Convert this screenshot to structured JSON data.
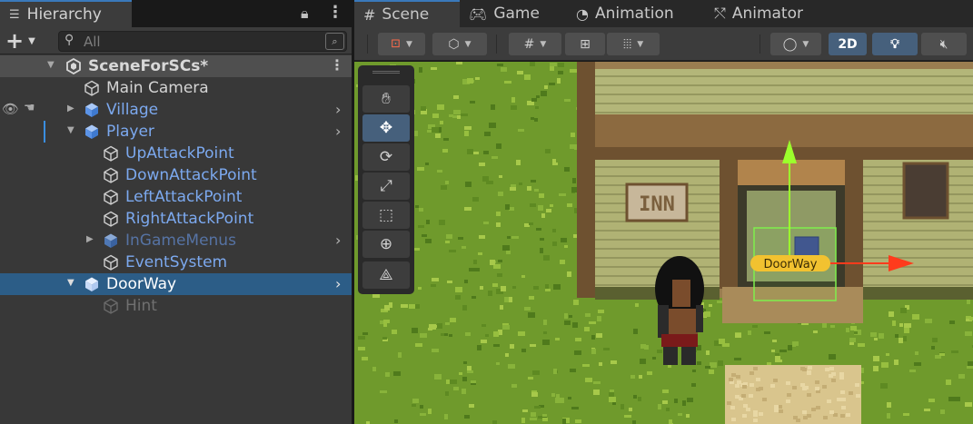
{
  "hierarchy": {
    "tab_label": "Hierarchy",
    "tab_icon": "list-icon",
    "search_placeholder": "All",
    "scene_name": "SceneForSCs*",
    "items": [
      {
        "label": "Main Camera"
      },
      {
        "label": "Village"
      },
      {
        "label": "Player"
      },
      {
        "label": "UpAttackPoint"
      },
      {
        "label": "DownAttackPoint"
      },
      {
        "label": "LeftAttackPoint"
      },
      {
        "label": "RightAttackPoint"
      },
      {
        "label": "InGameMenus"
      },
      {
        "label": "EventSystem"
      },
      {
        "label": "DoorWay"
      },
      {
        "label": "Hint"
      }
    ]
  },
  "scene_view": {
    "tabs": [
      {
        "label": "Scene",
        "icon": "grid-hash-icon"
      },
      {
        "label": "Game",
        "icon": "gamepad-icon"
      },
      {
        "label": "Animation",
        "icon": "clock-icon"
      },
      {
        "label": "Animator",
        "icon": "animator-icon"
      }
    ],
    "toolbar": {
      "mode_2d_label": "2D"
    },
    "tools": [
      "hand-tool",
      "move-tool",
      "rotate-tool",
      "scale-tool",
      "rect-tool",
      "transform-tool",
      "custom-tool"
    ],
    "gizmo_label": "DoorWay"
  },
  "colors": {
    "selection": "#2c5d87",
    "active_tab_accent": "#3a79bb",
    "prefab_blue": "#7ca9ef",
    "gizmo_x": "#ff3b1c",
    "gizmo_y": "#9cff2c",
    "gizmo_label_bg": "#f2c230"
  }
}
